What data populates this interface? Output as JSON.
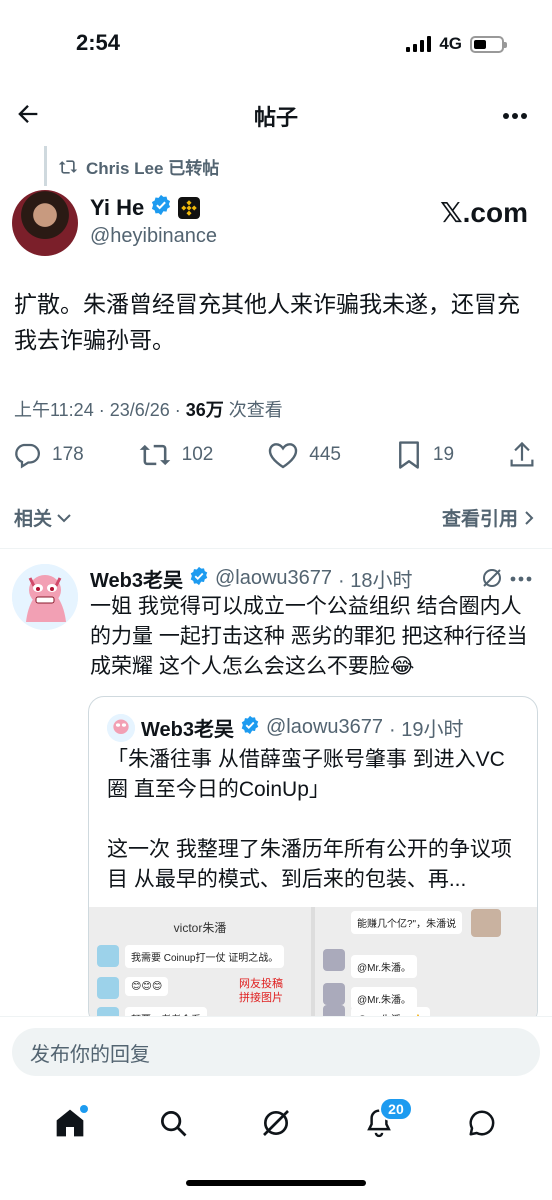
{
  "status_bar": {
    "time": "2:54",
    "network": "4G"
  },
  "header": {
    "title": "帖子"
  },
  "repost": {
    "text": "Chris Lee 已转帖"
  },
  "post": {
    "display_name": "Yi He",
    "handle": "@heyibinance",
    "source_logo": "𝕏.com",
    "text": "扩散。朱潘曾经冒充其他人来诈骗我未遂，还冒充我去诈骗孙哥。",
    "time": "上午11:24 · 23/6/26 · ",
    "views": "36万",
    "views_label": " 次查看",
    "counts": {
      "replies": "178",
      "reposts": "102",
      "likes": "445",
      "bookmarks": "19"
    }
  },
  "tabs": {
    "related": "相关",
    "quotes": "查看引用"
  },
  "reply": {
    "display_name": "Web3老吴",
    "handle": "@laowu3677",
    "time": "· 18小时",
    "text": "一姐 我觉得可以成立一个公益组织 结合圈内人的力量 一起打击这种 恶劣的罪犯 把这种行径当成荣耀 这个人怎么会这么不要脸😂",
    "quote": {
      "display_name": "Web3老吴",
      "handle": "@laowu3677",
      "time": "· 19小时",
      "line1": "「朱潘往事 从借薛蛮子账号肇事 到进入VC圈 直至今日的CoinUp」",
      "line2": "这一次 我整理了朱潘历年所有公开的争议项目 从最早的模式、到后来的包装、再...",
      "image": {
        "chat_title": "victor朱潘",
        "msg1": "我需要 Coinup打一仗 证明之战。",
        "msg2": "😊😊😊",
        "msg3": "颠覆，者者会看",
        "note": "网友投稿\n拼接图片",
        "right_top": "能赚几个亿?\"，朱潘说",
        "right_msg1": "@Mr.朱潘。",
        "right_msg2": "@Mr.朱潘。",
        "right_msg3": "@Mr.朱潘。👍"
      }
    }
  },
  "reply_box": {
    "placeholder": "发布你的回复"
  },
  "nav": {
    "notifications_count": "20"
  },
  "colors": {
    "accent": "#1d9bf0",
    "secondary_text": "#536471",
    "binance": "#f0b90b"
  }
}
